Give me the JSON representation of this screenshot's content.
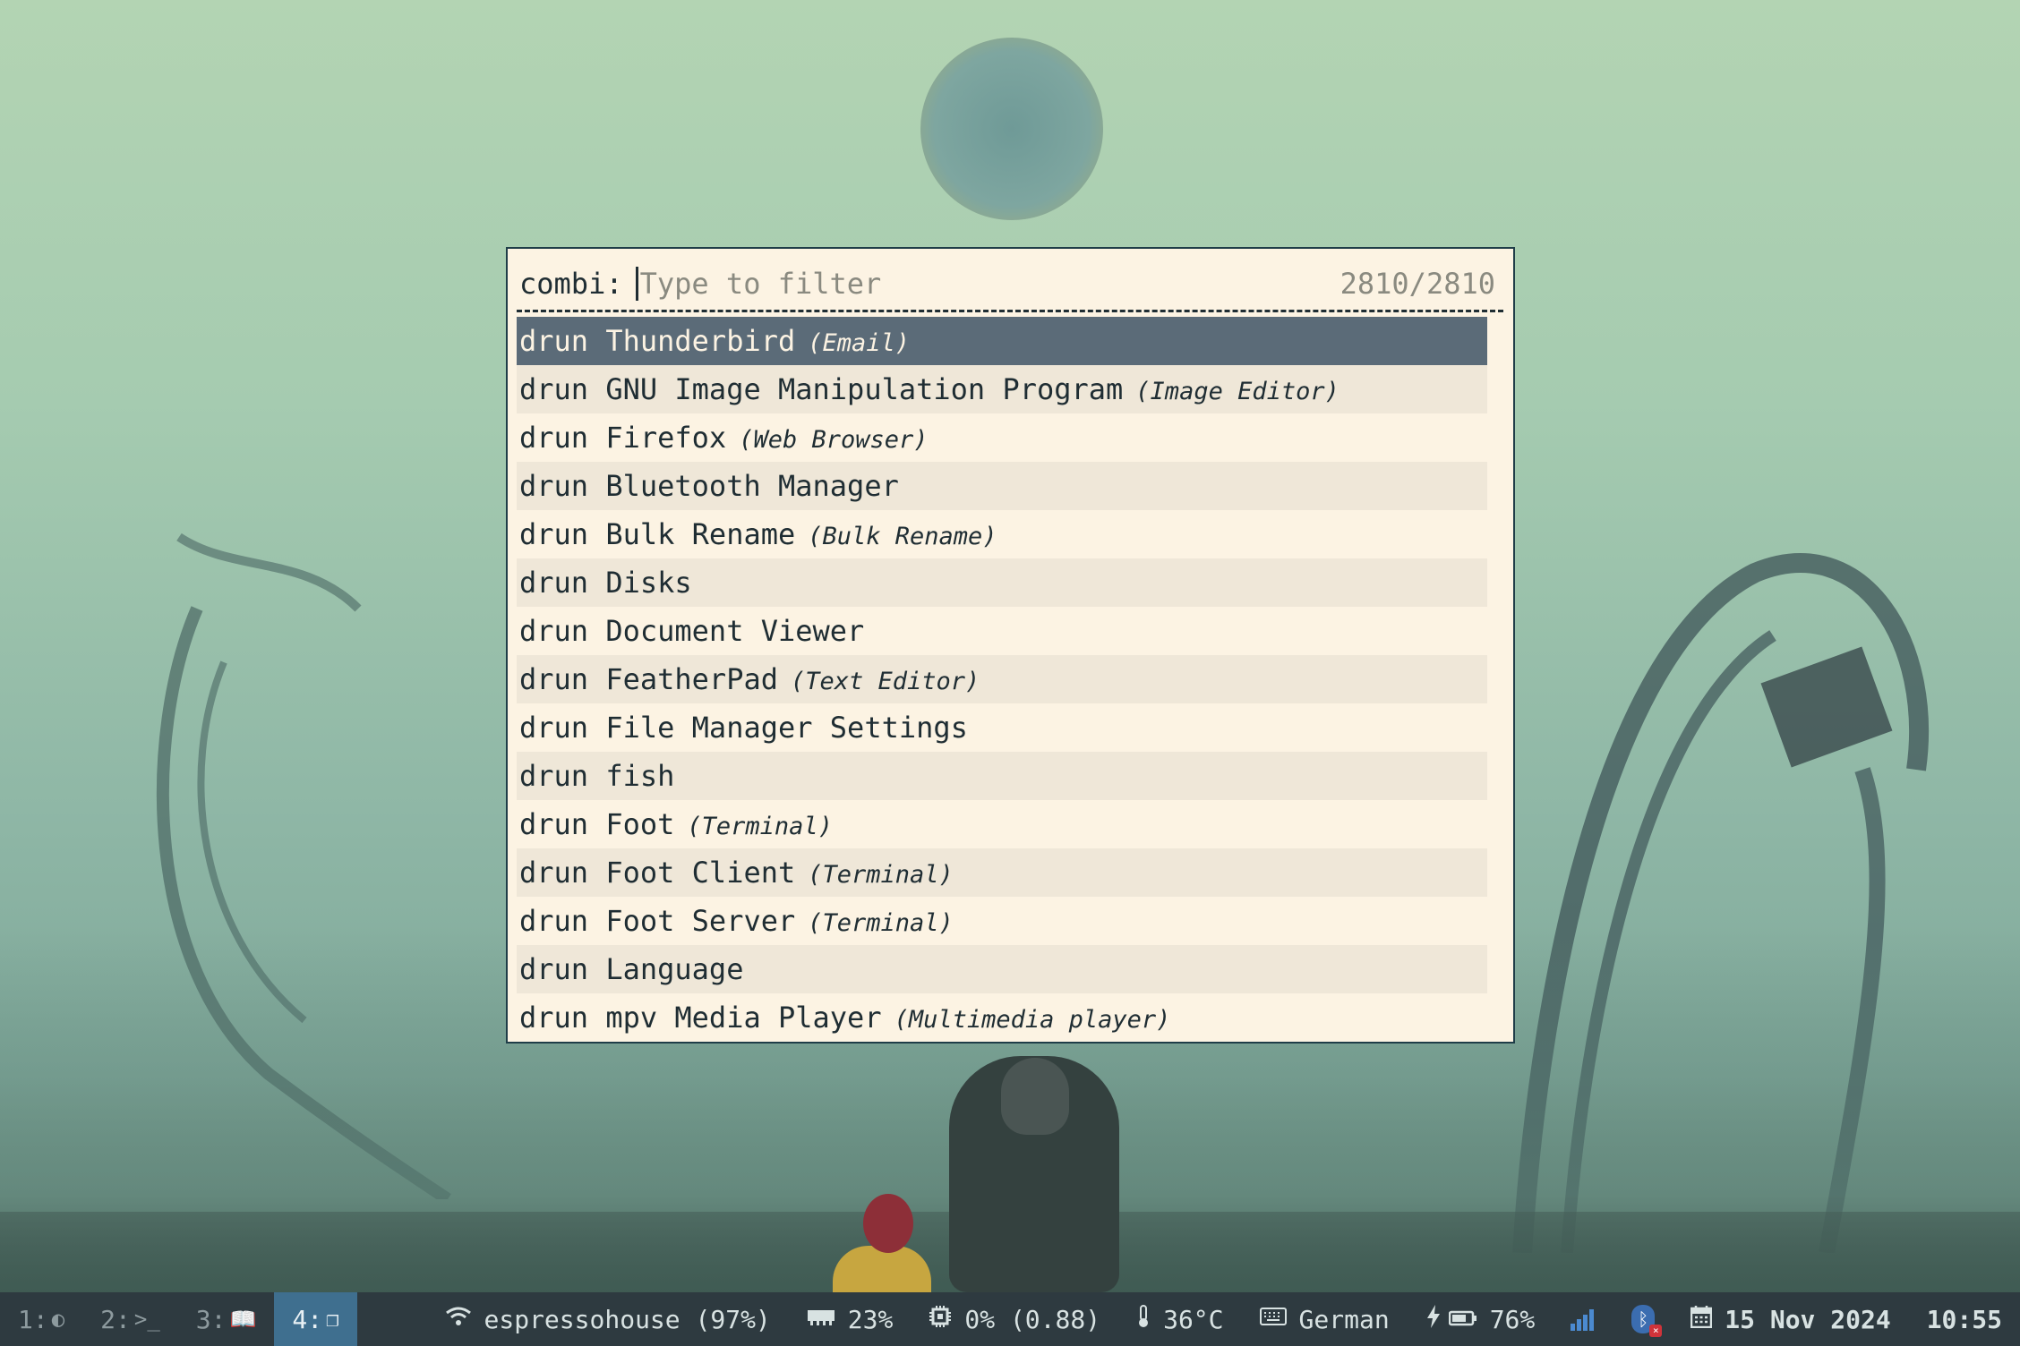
{
  "launcher": {
    "prompt": "combi:",
    "placeholder": "Type to filter",
    "count": "2810/2810",
    "entries": [
      {
        "text": "drun Thunderbird",
        "hint": "(Email)"
      },
      {
        "text": "drun GNU Image Manipulation Program",
        "hint": "(Image Editor)"
      },
      {
        "text": "drun Firefox",
        "hint": "(Web Browser)"
      },
      {
        "text": "drun Bluetooth Manager",
        "hint": ""
      },
      {
        "text": "drun Bulk Rename",
        "hint": "(Bulk Rename)"
      },
      {
        "text": "drun Disks",
        "hint": ""
      },
      {
        "text": "drun Document Viewer",
        "hint": ""
      },
      {
        "text": "drun FeatherPad",
        "hint": "(Text Editor)"
      },
      {
        "text": "drun File Manager Settings",
        "hint": ""
      },
      {
        "text": "drun fish",
        "hint": ""
      },
      {
        "text": "drun Foot",
        "hint": "(Terminal)"
      },
      {
        "text": "drun Foot Client",
        "hint": "(Terminal)"
      },
      {
        "text": "drun Foot Server",
        "hint": "(Terminal)"
      },
      {
        "text": "drun Language",
        "hint": ""
      },
      {
        "text": "drun mpv Media Player",
        "hint": "(Multimedia player)"
      }
    ]
  },
  "workspaces": [
    {
      "label": "1:",
      "icon": "◐",
      "icon_name": "moon-icon",
      "active": false
    },
    {
      "label": "2:",
      "icon": ">_",
      "icon_name": "terminal-icon",
      "active": false
    },
    {
      "label": "3:",
      "icon": "📖",
      "icon_name": "book-icon",
      "active": false
    },
    {
      "label": "4:",
      "icon": "❐",
      "icon_name": "windows-icon",
      "active": true
    }
  ],
  "status": {
    "wifi": "espressohouse (97%)",
    "memory": "23%",
    "cpu": "0% (0.88)",
    "temperature": "36°C",
    "keyboard": "German",
    "battery": "76%",
    "date": "15 Nov 2024",
    "time": "10:55"
  },
  "colors": {
    "accent": "#3f6f8f",
    "selected_row": "#5b6b78",
    "launcher_bg": "#fcf3e3",
    "bar_bg": "#2e3a40"
  }
}
